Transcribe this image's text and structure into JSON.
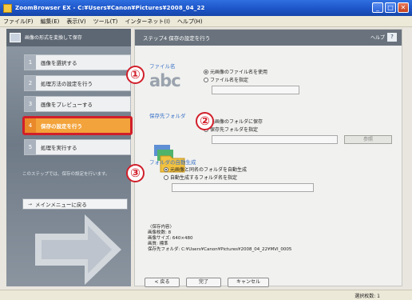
{
  "window": {
    "title": "ZoomBrowser EX - C:¥Users¥Canon¥Pictures¥2008_04_22",
    "min_label": "_",
    "max_label": "□",
    "close_label": "✕"
  },
  "menu": [
    "ファイル(F)",
    "編集(E)",
    "表示(V)",
    "ツール(T)",
    "インターネット(I)",
    "ヘルプ(H)"
  ],
  "left": {
    "header": "画像の形式を変換して保存",
    "steps": [
      {
        "num": "1",
        "label": "画像を選択する"
      },
      {
        "num": "2",
        "label": "処理方法の設定を行う"
      },
      {
        "num": "3",
        "label": "画像をプレビューする"
      },
      {
        "num": "4",
        "label": "保存の設定を行う"
      },
      {
        "num": "5",
        "label": "処理を実行する"
      }
    ],
    "help_text": "このステップでは、保存の設定を行います。",
    "menu_button": "メインメニューに戻る",
    "menu_arrow": "→"
  },
  "right": {
    "header": "ステップ4 保存の設定を行う",
    "help_label": "ヘルプ",
    "help_q": "?",
    "filename": {
      "section": "ファイル名",
      "abc": "abc",
      "opt1": "元画像のファイル名を使用",
      "opt2": "ファイル名を指定"
    },
    "folder": {
      "section": "保存先フォルダ",
      "opt1": "元画像のフォルダに保存",
      "opt2": "保存先フォルダを指定",
      "browse": "参照"
    },
    "autogen": {
      "section": "フォルダの自動生成",
      "opt1": "元画像と同名のフォルダを自動生成",
      "opt2": "自動生成するフォルダ名を指定"
    },
    "info": [
      "〈保存内容〉",
      "画像枚数: 8",
      "画像サイズ: 640×480",
      "画質: 標準",
      "保存先フォルダ: C:¥Users¥Canon¥Pictures¥2008_04_22¥MVI_0005"
    ]
  },
  "markers": [
    "①",
    "②",
    "③"
  ],
  "buttons": {
    "back": "< 戻る",
    "next": "完了",
    "cancel": "キャンセル"
  },
  "status": "選択枚数: 1",
  "colors": {
    "accent": "#d11f2a",
    "active_step": "#f3a33b",
    "section_label": "#3a72c8"
  }
}
